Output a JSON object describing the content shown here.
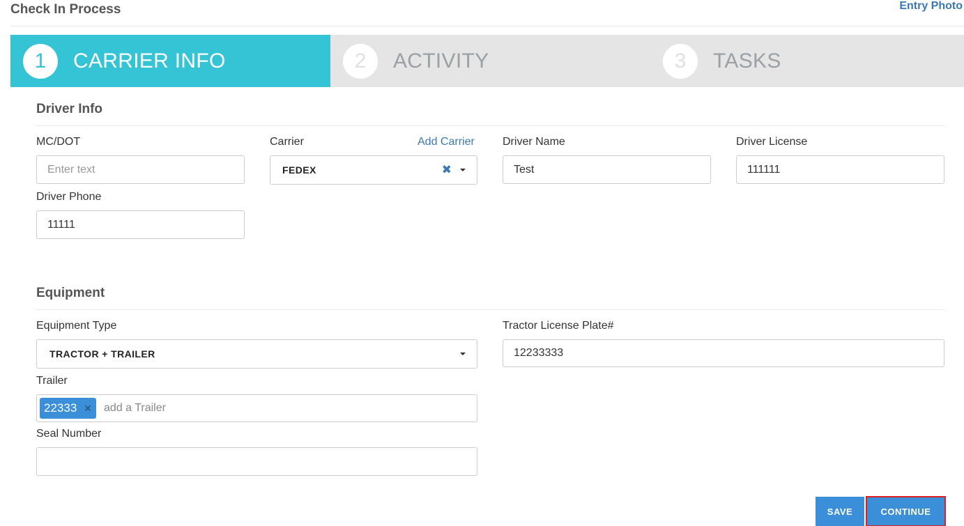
{
  "header": {
    "title": "Check In Process",
    "entry_photo_link": "Entry Photo"
  },
  "steps": [
    {
      "number": "1",
      "label": "CARRIER INFO",
      "active": true
    },
    {
      "number": "2",
      "label": "ACTIVITY",
      "active": false
    },
    {
      "number": "3",
      "label": "TASKS",
      "active": false
    }
  ],
  "driver_info": {
    "section_title": "Driver Info",
    "mc_dot": {
      "label": "MC/DOT",
      "value": "",
      "placeholder": "Enter text"
    },
    "carrier": {
      "label": "Carrier",
      "add_link": "Add Carrier",
      "value": "FEDEX"
    },
    "driver_name": {
      "label": "Driver Name",
      "value": "Test"
    },
    "driver_license": {
      "label": "Driver License",
      "value": "111111"
    },
    "driver_phone": {
      "label": "Driver Phone",
      "value": "11111"
    }
  },
  "equipment": {
    "section_title": "Equipment",
    "equipment_type": {
      "label": "Equipment Type",
      "value": "TRACTOR + TRAILER"
    },
    "tractor_license_plate": {
      "label": "Tractor License Plate#",
      "value": "12233333"
    },
    "trailer": {
      "label": "Trailer",
      "tags": [
        "22333"
      ],
      "placeholder": "add a Trailer"
    },
    "seal_number": {
      "label": "Seal Number",
      "value": ""
    }
  },
  "actions": {
    "save_label": "SAVE",
    "continue_label": "CONTINUE"
  },
  "colors": {
    "active_step": "#35c4d6",
    "primary_button": "#3a8fd8",
    "link": "#3a78b8",
    "highlight_border": "#e02020"
  }
}
